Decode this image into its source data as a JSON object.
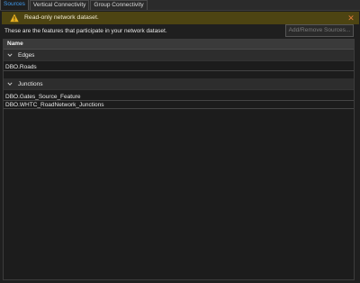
{
  "tabs": [
    {
      "label": "Sources",
      "active": true
    },
    {
      "label": "Vertical Connectivity",
      "active": false
    },
    {
      "label": "Group Connectivity",
      "active": false
    }
  ],
  "banner": {
    "message": "Read-only network dataset.",
    "icon": "warning-triangle-icon",
    "close_icon": "close-icon",
    "color": "#4d4412"
  },
  "description": "These are the features that participate in your network dataset.",
  "add_remove_label": "Add/Remove Sources...",
  "grid": {
    "column_header": "Name",
    "groups": [
      {
        "label": "Edges",
        "rows": [
          "DBO.Roads"
        ]
      },
      {
        "label": "Junctions",
        "rows": [
          "DBO.Gates_Source_Feature",
          "DBO.WHTC_RoadNetwork_Junctions"
        ]
      }
    ]
  },
  "colors": {
    "accent": "#3f9bf0",
    "background": "#1f1f1f",
    "warning": "#e8b020"
  }
}
